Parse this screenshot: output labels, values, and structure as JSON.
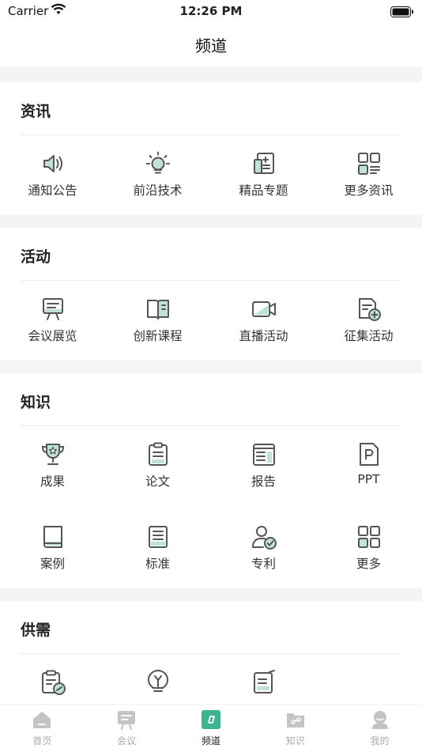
{
  "status_bar": {
    "carrier": "Carrier",
    "time": "12:26 PM"
  },
  "header": {
    "title": "频道"
  },
  "sections": [
    {
      "title": "资讯",
      "items": [
        {
          "label": "通知公告",
          "icon": "speaker-icon"
        },
        {
          "label": "前沿技术",
          "icon": "lightbulb-icon"
        },
        {
          "label": "精品专题",
          "icon": "document-plus-icon"
        },
        {
          "label": "更多资讯",
          "icon": "grid-list-icon"
        }
      ]
    },
    {
      "title": "活动",
      "items": [
        {
          "label": "会议展览",
          "icon": "presentation-board-icon"
        },
        {
          "label": "创新课程",
          "icon": "open-book-icon"
        },
        {
          "label": "直播活动",
          "icon": "video-camera-icon"
        },
        {
          "label": "征集活动",
          "icon": "document-add-icon"
        }
      ]
    },
    {
      "title": "知识",
      "items": [
        {
          "label": "成果",
          "icon": "trophy-icon"
        },
        {
          "label": "论文",
          "icon": "clipboard-icon"
        },
        {
          "label": "报告",
          "icon": "report-icon"
        },
        {
          "label": "PPT",
          "icon": "ppt-file-icon"
        },
        {
          "label": "案例",
          "icon": "book-icon"
        },
        {
          "label": "标准",
          "icon": "standard-doc-icon"
        },
        {
          "label": "专利",
          "icon": "patent-user-icon"
        },
        {
          "label": "更多",
          "icon": "grid-icon"
        }
      ]
    },
    {
      "title": "供需",
      "items": [
        {
          "label": "",
          "icon": "clipboard-link-icon"
        },
        {
          "label": "",
          "icon": "idea-bulb-icon"
        },
        {
          "label": "",
          "icon": "edit-doc-icon"
        }
      ]
    }
  ],
  "tabbar": [
    {
      "label": "首页",
      "icon": "home-icon",
      "active": false
    },
    {
      "label": "会议",
      "icon": "meeting-icon",
      "active": false
    },
    {
      "label": "频道",
      "icon": "channel-icon",
      "active": true
    },
    {
      "label": "知识",
      "icon": "knowledge-folder-icon",
      "active": false
    },
    {
      "label": "我的",
      "icon": "profile-icon",
      "active": false
    }
  ],
  "colors": {
    "accent": "#3bb48f",
    "accent_light": "#bfe3d6",
    "icon_stroke": "#555555",
    "tab_inactive": "#c4c4c4"
  }
}
